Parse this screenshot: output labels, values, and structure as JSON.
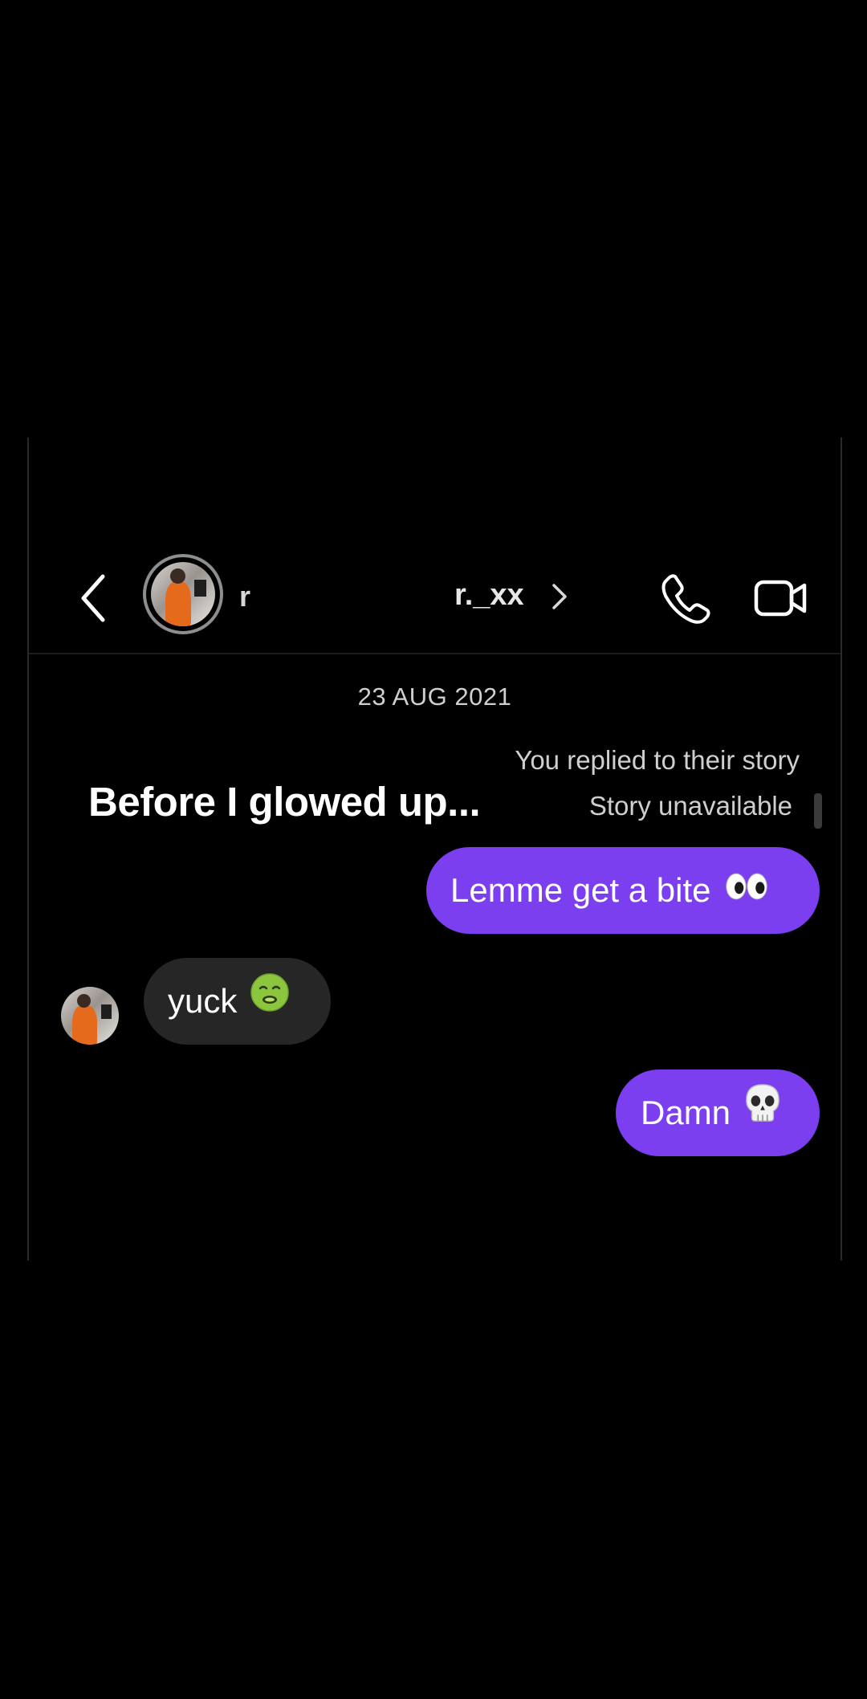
{
  "header": {
    "name_initial": "r",
    "username": "r._xx",
    "back_icon": "chevron-left-icon",
    "profile_chevron_icon": "chevron-right-icon",
    "call_icon": "phone-icon",
    "video_icon": "video-camera-icon"
  },
  "conversation": {
    "date": "23 AUG 2021",
    "story_reply": {
      "caption": "Before I glowed up...",
      "status": "You replied to their story",
      "availability": "Story unavailable"
    },
    "messages": [
      {
        "from": "me",
        "text": "Lemme get a bite",
        "emoji": "eyes"
      },
      {
        "from": "them",
        "text": "yuck",
        "emoji": "nauseated-face"
      },
      {
        "from": "me",
        "text": "Damn",
        "emoji": "skull"
      }
    ]
  },
  "colors": {
    "background": "#000000",
    "sent_bubble": "#7b3ff0",
    "received_bubble": "#262626",
    "secondary_text": "#cfcfcf"
  }
}
